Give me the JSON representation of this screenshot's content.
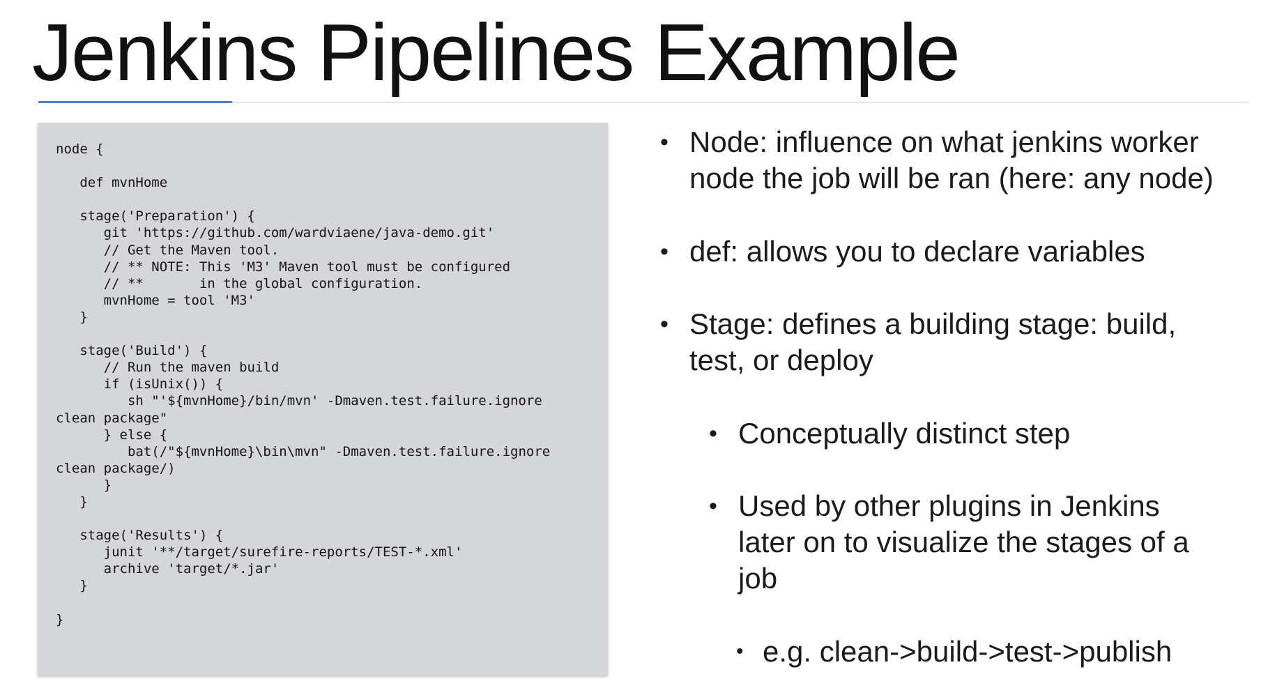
{
  "slide": {
    "title": "Jenkins Pipelines Example"
  },
  "code": {
    "text": "node {\n\n   def mvnHome\n\n   stage('Preparation') {\n      git 'https://github.com/wardviaene/java-demo.git'\n      // Get the Maven tool.\n      // ** NOTE: This 'M3' Maven tool must be configured\n      // **       in the global configuration.\n      mvnHome = tool 'M3'\n   }\n\n   stage('Build') {\n      // Run the maven build\n      if (isUnix()) {\n         sh \"'${mvnHome}/bin/mvn' -Dmaven.test.failure.ignore\nclean package\"\n      } else {\n         bat(/\"${mvnHome}\\bin\\mvn\" -Dmaven.test.failure.ignore\nclean package/)\n      }\n   }\n\n   stage('Results') {\n      junit '**/target/surefire-reports/TEST-*.xml'\n      archive 'target/*.jar'\n   }\n\n}"
  },
  "bullets": [
    {
      "level": 1,
      "lines": [
        "Node: influence on what jenkins worker",
        "node the job will be ran (here: any node)"
      ]
    },
    {
      "level": 1,
      "lines": [
        "def: allows you to declare variables"
      ]
    },
    {
      "level": 1,
      "lines": [
        "Stage: defines a building stage: build,",
        "test, or deploy"
      ]
    },
    {
      "level": 2,
      "lines": [
        "Conceptually distinct step"
      ]
    },
    {
      "level": 2,
      "lines": [
        "Used by other plugins in Jenkins",
        "later on to visualize the stages of a",
        "job"
      ]
    },
    {
      "level": 3,
      "lines": [
        "e.g. clean->build->test->publish"
      ]
    }
  ],
  "bullet_marker": "•"
}
